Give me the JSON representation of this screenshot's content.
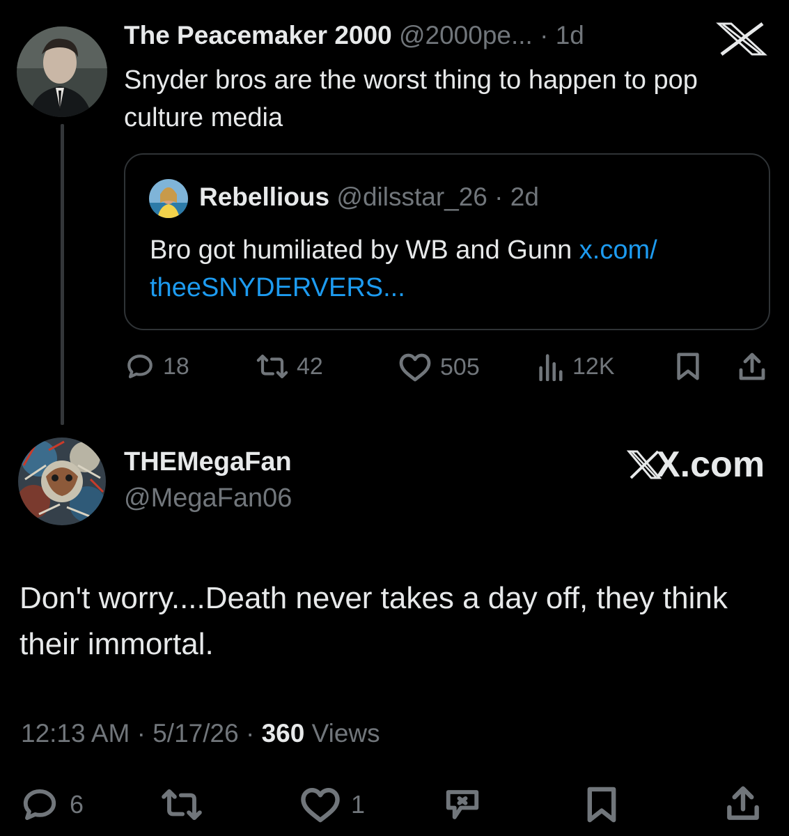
{
  "tweet": {
    "author_name": "The Peacemaker 2000",
    "handle": "@2000pe...",
    "time": "· 1d",
    "text": "Snyder bros are the worst thing to happen to pop culture media",
    "quote": {
      "author_name": "Rebellious",
      "handle": "@dilsstar_26",
      "time": "· 2d",
      "text": "Bro got humiliated by WB and Gunn ",
      "link": "x.com/ theeSNYDERVERS..."
    },
    "stats": {
      "replies": "18",
      "reposts": "42",
      "likes": "505",
      "views": "12K"
    }
  },
  "reply": {
    "author_name": "THEMegaFan",
    "handle": "@MegaFan06",
    "watermark": "X.com",
    "text": "Don't worry....Death never takes a day off, they think their immortal.",
    "meta": {
      "time": "12:13 AM",
      "sep1": " · ",
      "date": "5/17/26",
      "sep2": " · ",
      "views_count": "360",
      "views_label": " Views"
    },
    "stats": {
      "replies": "6",
      "likes": "1"
    }
  },
  "icons": {
    "x_logo": "x-logo-icon",
    "reply": "reply-icon",
    "repost": "repost-icon",
    "like": "heart-icon",
    "views": "views-icon",
    "bookmark": "bookmark-icon",
    "share": "share-icon",
    "grok": "grok-icon"
  },
  "colors": {
    "background": "#000000",
    "text": "#e7e9ea",
    "muted": "#71767b",
    "link": "#1d9bf0",
    "border": "#2f3336"
  }
}
